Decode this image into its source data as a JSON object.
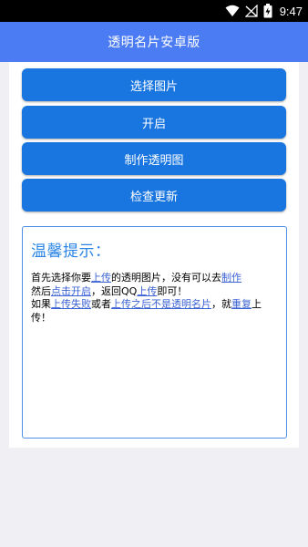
{
  "status": {
    "time": "9:47"
  },
  "app_bar": {
    "title": "透明名片安卓版"
  },
  "actions": {
    "select_image": "选择图片",
    "enable": "开启",
    "make_transparent": "制作透明图",
    "check_update": "检查更新"
  },
  "tips": {
    "title": "温馨提示：",
    "line1": {
      "t1": "首先选择你要",
      "l1": "上传",
      "t2": "的透明图片，没有可以去",
      "l2": "制作"
    },
    "line2": {
      "t1": "然后",
      "l1": "点击开启",
      "t2": "，返回QQ",
      "l2": "上传",
      "t3": "即可！"
    },
    "line3": {
      "t1": "如果",
      "l1": "上传失败",
      "t2": "或者",
      "l2": "上传之后不是透明名片",
      "t3": "，就",
      "l3": "重复",
      "t4": "上传！"
    }
  },
  "colors": {
    "app_bar": "#4c7cf3",
    "button": "#1976e0",
    "tips_title": "#2a85e6",
    "link": "#3b62d4",
    "background": "#efeff4"
  }
}
